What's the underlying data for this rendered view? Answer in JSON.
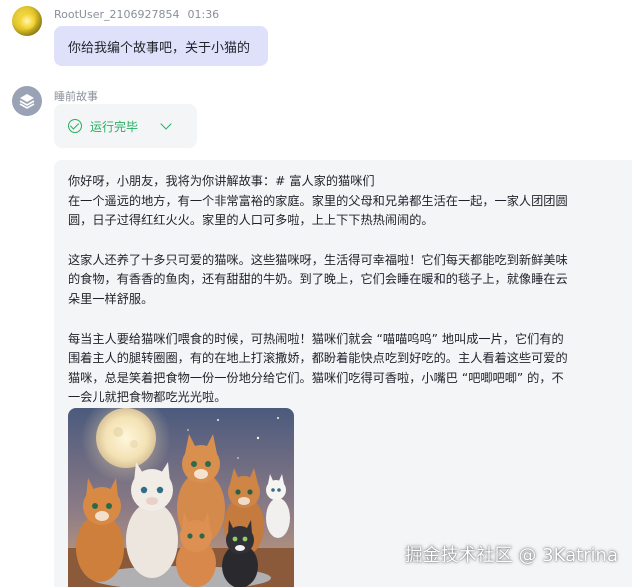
{
  "user": {
    "name": "RootUser_2106927854",
    "time": "01:36",
    "message": "你给我编个故事吧，关于小猫的"
  },
  "bot": {
    "name": "睡前故事",
    "status": {
      "label": "运行完毕",
      "icon": "check-circle-icon",
      "color": "#27ae60"
    },
    "story": {
      "lines_p1": [
        "你好呀，小朋友，我将为你讲解故事：# 富人家的猫咪们",
        "在一个遥远的地方，有一个非常富裕的家庭。家里的父母和兄弟都生活在一起，一家人团团圆",
        "圆，日子过得红红火火。家里的人口可多啦，上上下下热热闹闹的。"
      ],
      "lines_p2": [
        "这家人还养了十多只可爱的猫咪。这些猫咪呀，生活得可幸福啦！它们每天都能吃到新鲜美味",
        "的食物，有香香的鱼肉，还有甜甜的牛奶。到了晚上，它们会睡在暖和的毯子上，就像睡在云",
        "朵里一样舒服。"
      ],
      "lines_p3": [
        "每当主人要给猫咪们喂食的时候，可热闹啦！猫咪们就会 “喵喵呜呜” 地叫成一片，它们有的",
        "围着主人的腿转圈圈，有的在地上打滚撒娇，都盼着能快点吃到好吃的。主人看着这些可爱的",
        "猫咪，总是笑着把食物一份一份地分给它们。猫咪们吃得可香啦，小嘴巴 “吧唧吧唧” 的，不",
        "一会儿就把食物都吃光光啦。"
      ]
    }
  },
  "watermark": "掘金技术社区 @ 3Katrina",
  "colors": {
    "user_bubble": "#dfe1fb",
    "bot_bubble": "#f3f5f7",
    "success": "#27ae60"
  }
}
